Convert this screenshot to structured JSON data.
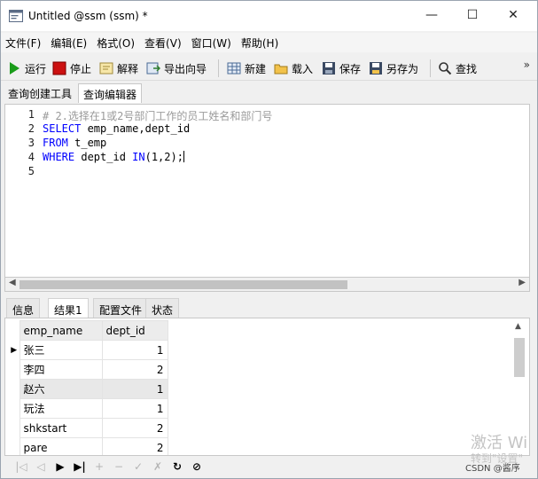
{
  "window": {
    "title": "Untitled @ssm (ssm) *",
    "minimize": "—",
    "maximize": "☐",
    "close": "✕"
  },
  "menu": [
    "文件(F)",
    "编辑(E)",
    "格式(O)",
    "查看(V)",
    "窗口(W)",
    "帮助(H)"
  ],
  "toolbar": {
    "run": "运行",
    "stop": "停止",
    "explain": "解释",
    "export_wizard": "导出向导",
    "new": "新建",
    "load": "载入",
    "save": "保存",
    "save_as": "另存为",
    "find": "查找",
    "more": "»"
  },
  "subtabs": [
    "查询创建工具",
    "查询编辑器"
  ],
  "editor": {
    "line_numbers": [
      "1",
      "2",
      "3",
      "4",
      "5"
    ],
    "line1_comment": "# 2.选择在1或2号部门工作的员工姓名和部门号",
    "line2_kw": "SELECT",
    "line2_rest": " emp_name,dept_id",
    "line3_kw": "FROM",
    "line3_rest": " t_emp",
    "line4_kw1": "WHERE",
    "line4_mid": " dept_id ",
    "line4_kw2": "IN",
    "line4_rest": "(1,2);"
  },
  "result_tabs": [
    "信息",
    "结果1",
    "配置文件",
    "状态"
  ],
  "grid": {
    "columns": [
      "emp_name",
      "dept_id"
    ],
    "rows": [
      [
        "张三",
        "1"
      ],
      [
        "李四",
        "2"
      ],
      [
        "赵六",
        "1"
      ],
      [
        "玩法",
        "1"
      ],
      [
        "shkstart",
        "2"
      ],
      [
        "pare",
        "2"
      ]
    ],
    "current_row_marker": "▶"
  },
  "navbar": [
    "|◁",
    "◁",
    "▶",
    "▶|",
    "+",
    "−",
    "✓",
    "✗",
    "↻",
    "⊘"
  ],
  "watermark": {
    "line1": "激活 Wi",
    "line2": "转到\"设置\"",
    "credit": "CSDN @酱序"
  },
  "colors": {
    "keyword": "#0000ff",
    "comment": "#9a9a9a",
    "run_icon": "#1a9c1a",
    "stop_icon": "#cc1111"
  }
}
